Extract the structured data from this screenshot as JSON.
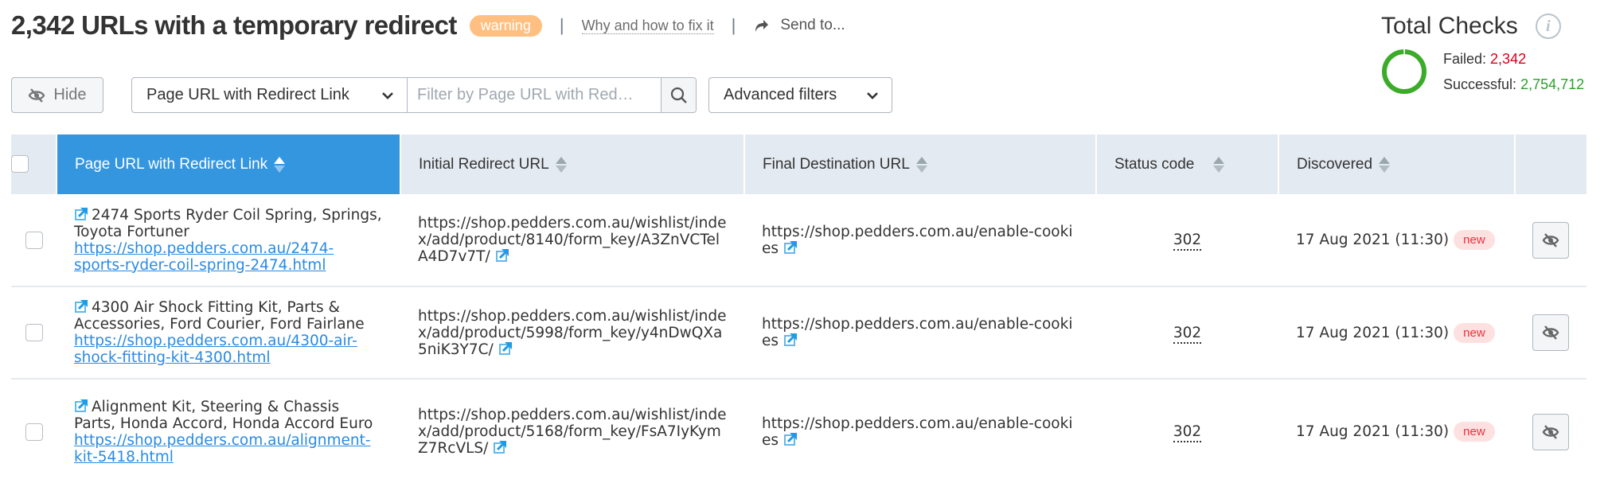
{
  "header": {
    "title": "2,342 URLs with a temporary redirect",
    "badge": "warning",
    "fix_link": "Why and how to fix it",
    "send_to": "Send to..."
  },
  "total_checks": {
    "title": "Total Checks",
    "info_icon": "i",
    "failed_label": "Failed:",
    "failed_value": "2,342",
    "successful_label": "Successful:",
    "successful_value": "2,754,712",
    "colors": {
      "failed": "#d0021b",
      "successful": "#2ca02c"
    }
  },
  "toolbar": {
    "hide_label": "Hide",
    "filter_select": "Page URL with Redirect Link",
    "filter_placeholder": "Filter by Page URL with Red…",
    "filter_value": "",
    "advanced_filters": "Advanced filters"
  },
  "table": {
    "columns": [
      {
        "label": "Page URL with Redirect Link",
        "sorted": true
      },
      {
        "label": "Initial Redirect URL"
      },
      {
        "label": "Final Destination URL"
      },
      {
        "label": "Status code"
      },
      {
        "label": "Discovered"
      }
    ],
    "rows": [
      {
        "page_title": "2474 Sports Ryder Coil Spring, Springs, Toyota Fortuner",
        "page_url": "https://shop.pedders.com.au/2474-sports-ryder-coil-spring-2474.html",
        "initial_url": "https://shop.pedders.com.au/wishlist/index/add/product/8140/form_key/A3ZnVCTelA4D7v7T/",
        "final_url": "https://shop.pedders.com.au/enable-cookies",
        "status": "302",
        "discovered": "17 Aug 2021 (11:30)",
        "badge": "new"
      },
      {
        "page_title": "4300 Air Shock Fitting Kit, Parts & Accessories, Ford Courier, Ford Fairlane",
        "page_url": "https://shop.pedders.com.au/4300-air-shock-fitting-kit-4300.html",
        "initial_url": "https://shop.pedders.com.au/wishlist/index/add/product/5998/form_key/y4nDwQXa5niK3Y7C/",
        "final_url": "https://shop.pedders.com.au/enable-cookies",
        "status": "302",
        "discovered": "17 Aug 2021 (11:30)",
        "badge": "new"
      },
      {
        "page_title": "Alignment Kit, Steering & Chassis Parts, Honda Accord, Honda Accord Euro",
        "page_url": "https://shop.pedders.com.au/alignment-kit-5418.html",
        "initial_url": "https://shop.pedders.com.au/wishlist/index/add/product/5168/form_key/FsA7IyKymZ7RcVLS/",
        "final_url": "https://shop.pedders.com.au/enable-cookies",
        "status": "302",
        "discovered": "17 Aug 2021 (11:30)",
        "badge": "new"
      }
    ]
  },
  "colors": {
    "accent": "#3596e0",
    "link": "#2a8ae2",
    "warning_badge": "#ffbf80",
    "new_badge_bg": "#fde0e0",
    "new_badge_text": "#e8323c",
    "header_bg": "#e4eaf1"
  }
}
